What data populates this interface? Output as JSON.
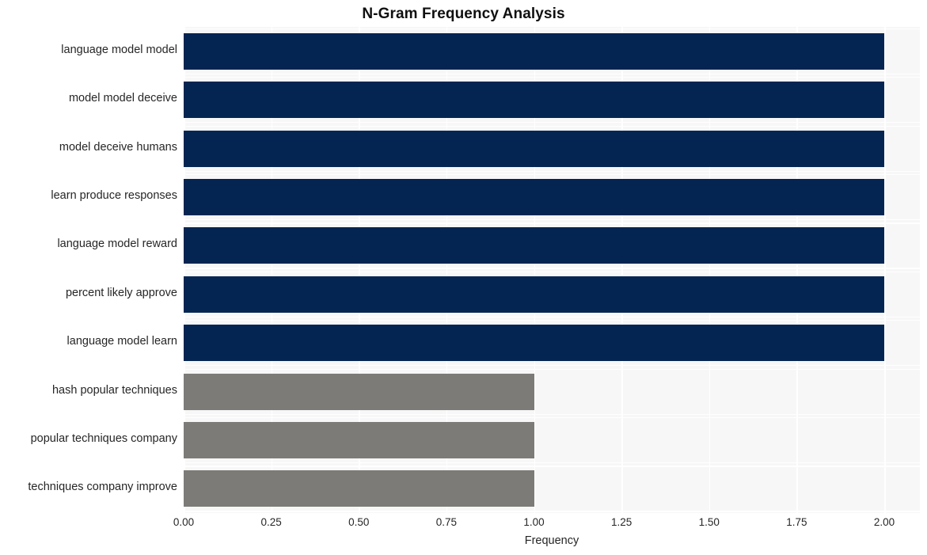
{
  "chart_data": {
    "type": "bar",
    "orientation": "horizontal",
    "title": "N-Gram Frequency Analysis",
    "xlabel": "Frequency",
    "ylabel": "",
    "xlim": [
      0,
      2
    ],
    "xticks": [
      "0.00",
      "0.25",
      "0.50",
      "0.75",
      "1.00",
      "1.25",
      "1.50",
      "1.75",
      "2.00"
    ],
    "xtick_values": [
      0,
      0.25,
      0.5,
      0.75,
      1.0,
      1.25,
      1.5,
      1.75,
      2.0
    ],
    "grid": true,
    "legend": null,
    "categories": [
      "language model model",
      "model model deceive",
      "model deceive humans",
      "learn produce responses",
      "language model reward",
      "percent likely approve",
      "language model learn",
      "hash popular techniques",
      "popular techniques company",
      "techniques company improve"
    ],
    "values": [
      2,
      2,
      2,
      2,
      2,
      2,
      2,
      1,
      1,
      1
    ],
    "bar_colors": [
      "#042552",
      "#042552",
      "#042552",
      "#042552",
      "#042552",
      "#042552",
      "#042552",
      "#7c7b77",
      "#7c7b77",
      "#7c7b77"
    ]
  },
  "style": {
    "plot_background": "#f7f7f7",
    "figure_background": "#ffffff",
    "gridline_color": "#ffffff",
    "text_color": "#262626",
    "title_color": "#101010",
    "accent_navy": "#042552",
    "accent_gray": "#7c7b77"
  }
}
